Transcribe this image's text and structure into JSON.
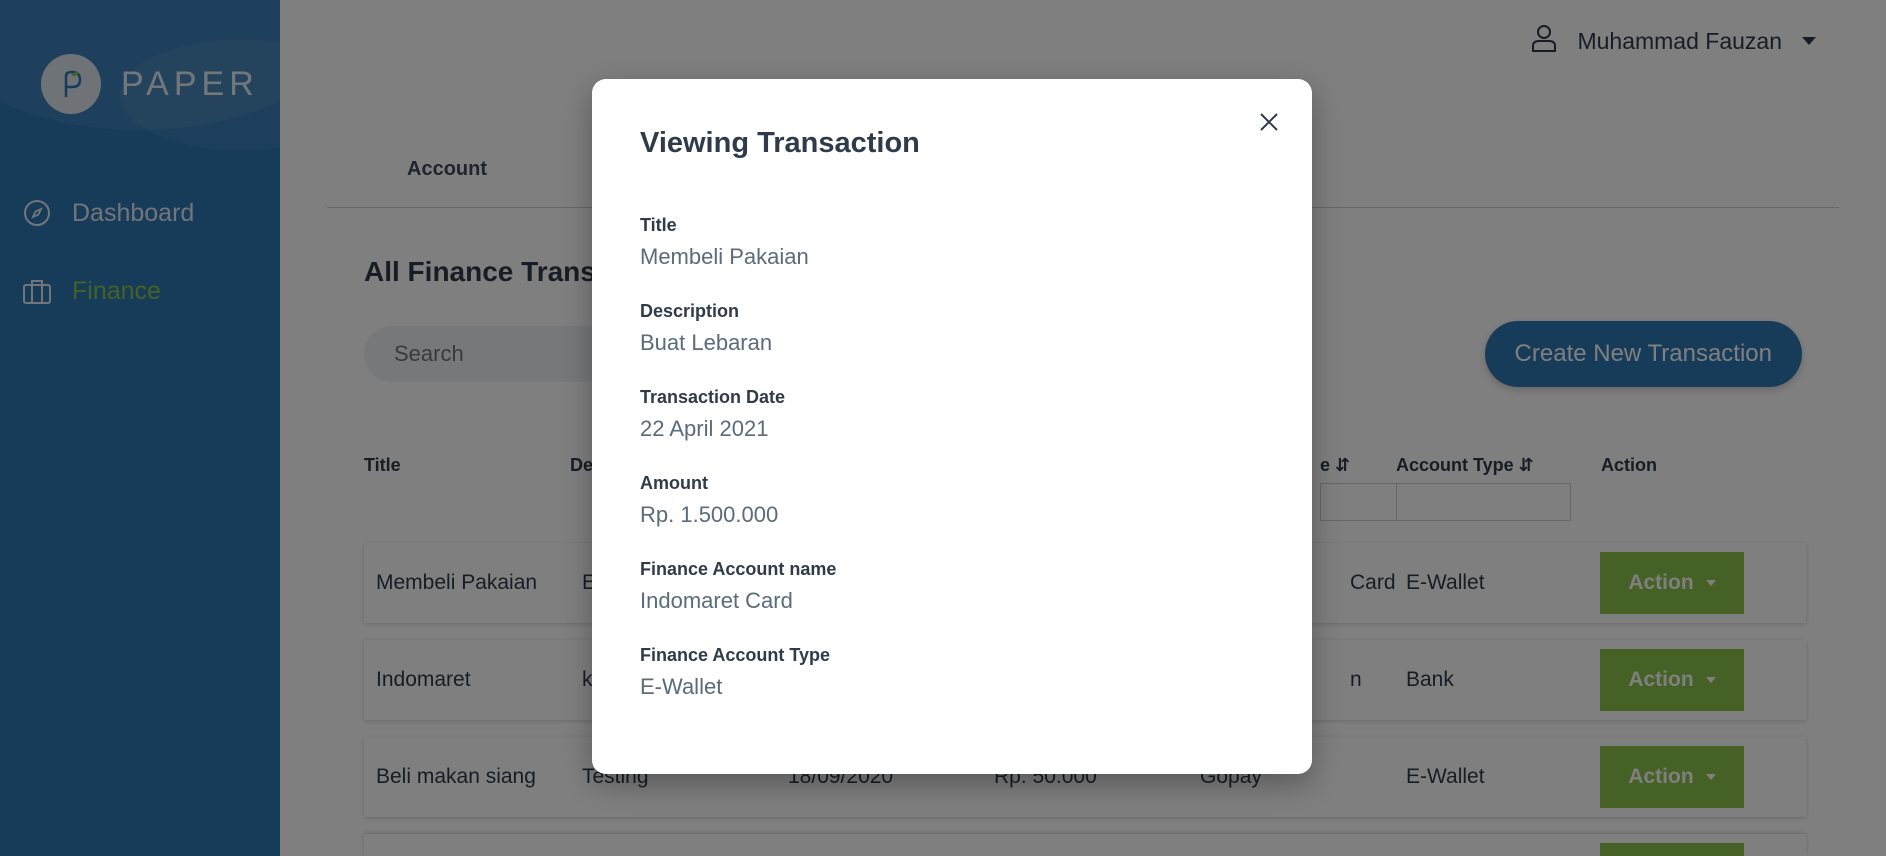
{
  "app": {
    "logo_text": "PAPER"
  },
  "sidebar": {
    "items": [
      {
        "label": "Dashboard",
        "icon": "compass-icon"
      },
      {
        "label": "Finance",
        "icon": "briefcase-icon"
      }
    ]
  },
  "header": {
    "user_name": "Muhammad Fauzan"
  },
  "tabs": [
    {
      "label": "Account"
    }
  ],
  "main": {
    "page_title": "All Finance Transa",
    "search_placeholder": "Search",
    "create_button": "Create New Transaction"
  },
  "table": {
    "headers": [
      {
        "label": "Title"
      },
      {
        "label": "De"
      },
      {
        "label": "e ⇵"
      },
      {
        "label": "Account Type ⇵"
      },
      {
        "label": "Action"
      }
    ],
    "rows": [
      {
        "title": "Membeli Pakaian",
        "description": "E",
        "date": "",
        "amount": "",
        "account": "Card",
        "account_type": "E-Wallet",
        "action": "Action"
      },
      {
        "title": "Indomaret",
        "description": "k",
        "date": "",
        "amount": "",
        "account": "n",
        "account_type": "Bank",
        "action": "Action"
      },
      {
        "title": "Beli makan siang",
        "description": "Testing",
        "date": "18/09/2020",
        "amount": "Rp. 50.000",
        "account": "Gopay",
        "account_type": "E-Wallet",
        "action": "Action"
      }
    ]
  },
  "modal": {
    "title": "Viewing Transaction",
    "fields": [
      {
        "label": "Title",
        "value": "Membeli Pakaian"
      },
      {
        "label": "Description",
        "value": "Buat Lebaran"
      },
      {
        "label": "Transaction Date",
        "value": "22 April 2021"
      },
      {
        "label": "Amount",
        "value": "Rp. 1.500.000"
      },
      {
        "label": "Finance Account name",
        "value": "Indomaret Card"
      },
      {
        "label": "Finance Account Type",
        "value": "E-Wallet"
      }
    ]
  },
  "colors": {
    "sidebar": "#2f78b4",
    "accent_green": "#8bc34a",
    "text_dark": "#2f3b4a",
    "overlay": "rgba(0,0,0,0.5)"
  }
}
